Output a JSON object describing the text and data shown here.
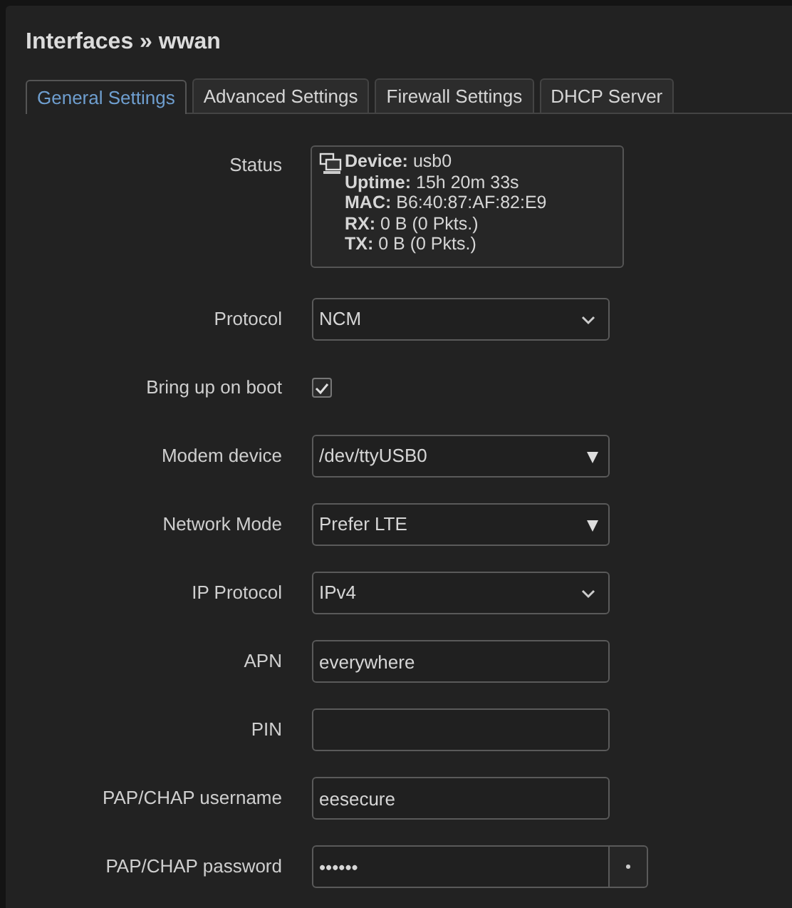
{
  "title": "Interfaces » wwan",
  "tabs": [
    {
      "label": "General Settings",
      "selected": true
    },
    {
      "label": "Advanced Settings",
      "selected": false
    },
    {
      "label": "Firewall Settings",
      "selected": false
    },
    {
      "label": "DHCP Server",
      "selected": false
    }
  ],
  "status": {
    "label": "Status",
    "lines": [
      "**Device:** usb0",
      "**Uptime:** 15h 20m 33s",
      "**MAC:** B6:40:87:AF:82:E9",
      "**RX:** 0 B (0 Pkts.)",
      "**TX:** 0 B (0 Pkts.)"
    ]
  },
  "fields": [
    {
      "kind": "select",
      "label": "Protocol",
      "value": "NCM"
    },
    {
      "kind": "checkbox",
      "label": "Bring up on boot",
      "checked": true
    },
    {
      "kind": "dropdown",
      "label": "Modem device",
      "value": "/dev/ttyUSB0"
    },
    {
      "kind": "dropdown",
      "label": "Network Mode",
      "value": "Prefer LTE"
    },
    {
      "kind": "select",
      "label": "IP Protocol",
      "value": "IPv4"
    },
    {
      "kind": "text",
      "label": "APN",
      "value": "everywhere"
    },
    {
      "kind": "text",
      "label": "PIN"
    },
    {
      "kind": "text",
      "label": "PAP/CHAP username",
      "value": "eesecure"
    },
    {
      "kind": "password",
      "label": "PAP/CHAP password",
      "value": "••••••"
    }
  ]
}
